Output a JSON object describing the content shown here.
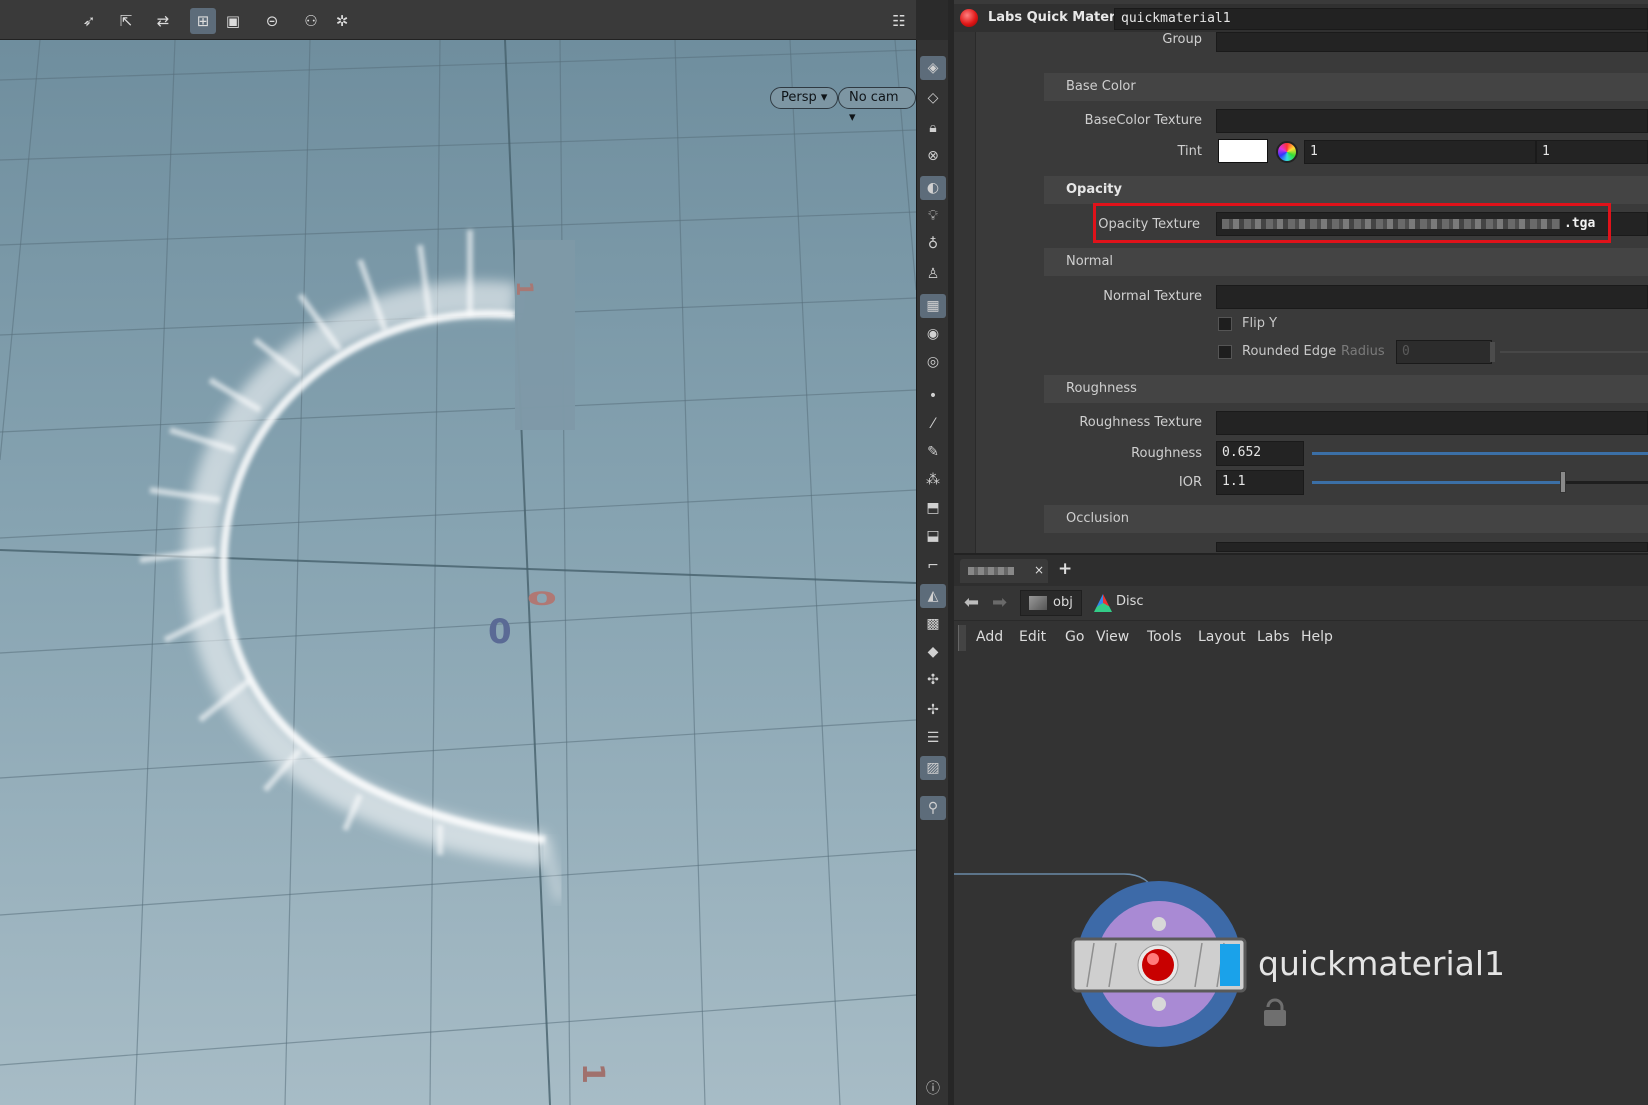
{
  "viewport": {
    "persp_label": "Persp",
    "cam_label": "No cam",
    "axis_labels": [
      "0",
      "0",
      "1",
      "1"
    ]
  },
  "param_pane": {
    "node_type": "Labs Quick Material",
    "node_name": "quickmaterial1",
    "group_label": "Group",
    "folders": {
      "base_color": "Base Color",
      "opacity": "Opacity",
      "normal": "Normal",
      "roughness": "Roughness",
      "occlusion": "Occlusion"
    },
    "basecolor_texture_label": "BaseColor Texture",
    "tint_label": "Tint",
    "tint_value_1": "1",
    "tint_value_2": "1",
    "opacity_texture_label": "Opacity Texture",
    "opacity_texture_value": ".tga",
    "normal_texture_label": "Normal Texture",
    "flip_y_label": "Flip Y",
    "rounded_edge_label": "Rounded Edge",
    "radius_label": "Radius",
    "radius_value": "0",
    "roughness_texture_label": "Roughness Texture",
    "roughness_label": "Roughness",
    "roughness_value": "0.652",
    "ior_label": "IOR",
    "ior_value": "1.1",
    "roughness_level": 0.652,
    "ior_level": 0.55
  },
  "network": {
    "tab_close": "×",
    "tab_add": "+",
    "path_obj": "obj",
    "path_disc": "Disc",
    "menu": [
      "Add",
      "Edit",
      "Go",
      "View",
      "Tools",
      "Layout",
      "Labs",
      "Help"
    ],
    "node_label": "quickmaterial1"
  },
  "colors": {
    "highlight": "#e0121a",
    "accent": "#3b6fa6"
  }
}
